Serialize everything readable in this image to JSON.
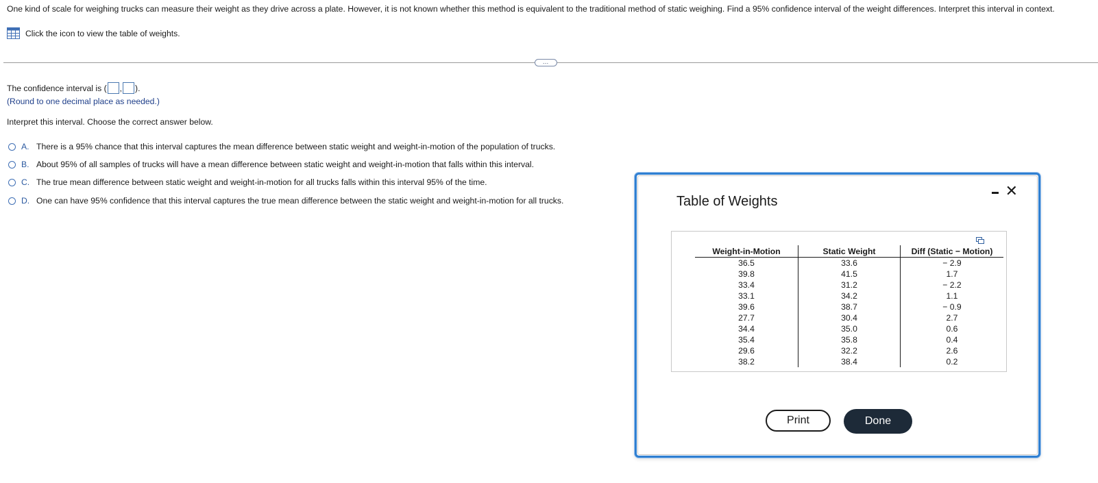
{
  "question": {
    "text": "One kind of scale for weighing trucks can measure their weight as they drive across a plate. However, it is not known whether this method is equivalent to the traditional method of static weighing. Find a 95% confidence interval of the weight differences. Interpret this interval in context.",
    "table_link_text": "Click the icon to view the table of weights."
  },
  "expand_button": "…",
  "answer": {
    "ci_prefix": "The confidence interval is (",
    "ci_separator": ",",
    "ci_suffix": ").",
    "lower_value": "",
    "upper_value": "",
    "round_note": "(Round to one decimal place as needed.)",
    "interpret_prompt": "Interpret this interval. Choose the correct answer below."
  },
  "options": [
    {
      "letter": "A.",
      "text": "There is a 95% chance that this interval captures the mean difference between static weight and weight-in-motion of the population of trucks."
    },
    {
      "letter": "B.",
      "text": "About 95% of all samples of trucks will have a mean difference between static weight and weight-in-motion that falls within this interval."
    },
    {
      "letter": "C.",
      "text": "The true mean difference between static weight and weight-in-motion for all trucks falls within this interval 95% of the time."
    },
    {
      "letter": "D.",
      "text": "One can have 95% confidence that this interval captures the true mean difference between the static weight and weight-in-motion for all trucks."
    }
  ],
  "modal": {
    "title": "Table of Weights",
    "close_glyph": "✕",
    "print_label": "Print",
    "done_label": "Done",
    "table": {
      "headers": [
        "Weight-in-Motion",
        "Static Weight",
        "Diff (Static − Motion)"
      ],
      "rows": [
        [
          "36.5",
          "33.6",
          "− 2.9"
        ],
        [
          "39.8",
          "41.5",
          "1.7"
        ],
        [
          "33.4",
          "31.2",
          "− 2.2"
        ],
        [
          "33.1",
          "34.2",
          "1.1"
        ],
        [
          "39.6",
          "38.7",
          "− 0.9"
        ],
        [
          "27.7",
          "30.4",
          "2.7"
        ],
        [
          "34.4",
          "35.0",
          "0.6"
        ],
        [
          "35.4",
          "35.8",
          "0.4"
        ],
        [
          "29.6",
          "32.2",
          "2.6"
        ],
        [
          "38.2",
          "38.4",
          "0.2"
        ]
      ]
    }
  },
  "colors": {
    "modal_border": "#2f7fd1",
    "link_blue": "#1f3f8a",
    "done_bg": "#1d2a38"
  }
}
